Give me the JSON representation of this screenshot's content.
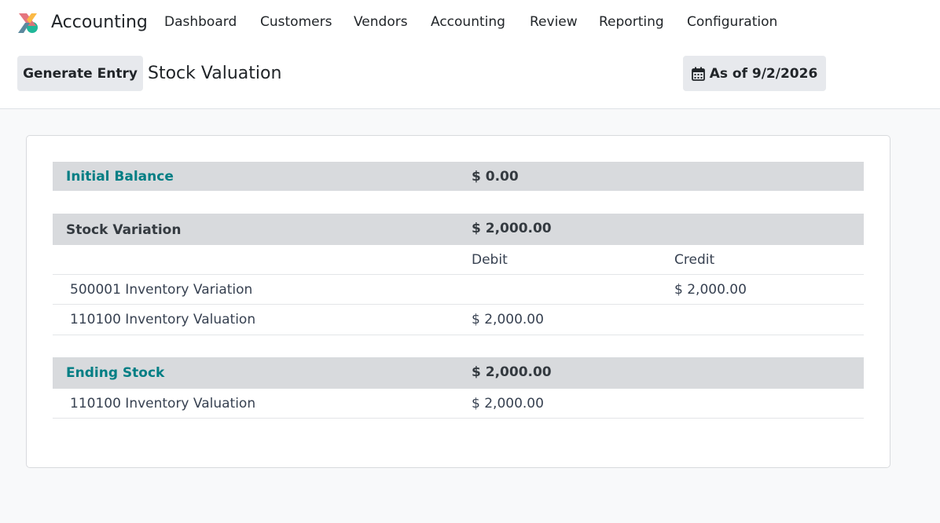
{
  "navbar": {
    "app_name": "Accounting",
    "logo_icon": "odoo-accounting-logo-icon",
    "items": [
      "Dashboard",
      "Customers",
      "Vendors",
      "Accounting",
      "Review",
      "Reporting",
      "Configuration"
    ]
  },
  "control_panel": {
    "generate_label": "Generate Entry",
    "title": "Stock Valuation",
    "date_icon": "calendar-icon",
    "date_label": "As of 9/2/2026"
  },
  "report": {
    "initial_balance": {
      "label": "Initial Balance",
      "value": "$ 0.00"
    },
    "stock_variation": {
      "label": "Stock Variation",
      "value": "$ 2,000.00",
      "col_debit": "Debit",
      "col_credit": "Credit",
      "lines": [
        {
          "account": "500001 Inventory Variation",
          "debit": "",
          "credit": "$ 2,000.00"
        },
        {
          "account": "110100 Inventory Valuation",
          "debit": "$ 2,000.00",
          "credit": ""
        }
      ]
    },
    "ending_stock": {
      "label": "Ending Stock",
      "value": "$ 2,000.00",
      "lines": [
        {
          "account": "110100 Inventory Valuation",
          "debit": "$ 2,000.00"
        }
      ]
    }
  },
  "colors": {
    "accent_teal": "#017e84",
    "band_bg": "#d8dadd",
    "button_bg": "#e7e9ed",
    "page_bg": "#f8f9fa"
  }
}
